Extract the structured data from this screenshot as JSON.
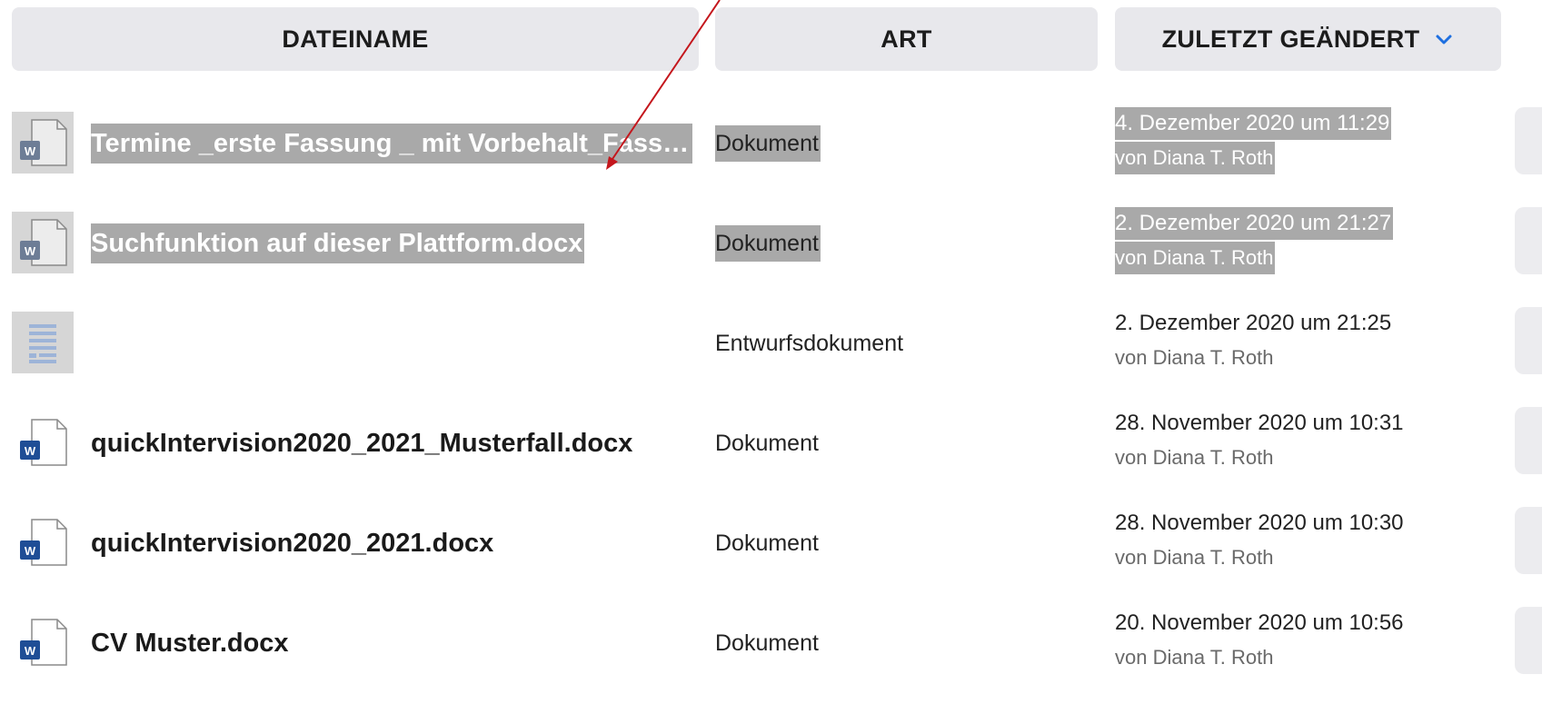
{
  "headers": {
    "name": "DATEINAME",
    "type": "ART",
    "date": "ZULETZT GEÄNDERT"
  },
  "rows": [
    {
      "name": "Termine _erste Fassung _ mit Vorbehalt_Fassung",
      "type": "Dokument",
      "date": "4. Dezember 2020 um 11:29",
      "by": "von Diana T. Roth",
      "icon": "word-doc-icon",
      "selected": true
    },
    {
      "name": "Suchfunktion auf dieser Plattform.docx",
      "type": "Dokument",
      "date": "2. Dezember 2020 um 21:27",
      "by": "von Diana T. Roth",
      "icon": "word-doc-icon",
      "selected": true
    },
    {
      "name": "",
      "type": "Entwurfsdokument",
      "date": "2. Dezember 2020 um 21:25",
      "by": "von Diana T. Roth",
      "icon": "draft-doc-icon",
      "selected": false
    },
    {
      "name": "quickIntervision2020_2021_Musterfall.docx",
      "type": "Dokument",
      "date": "28. November 2020 um 10:31",
      "by": "von Diana T. Roth",
      "icon": "word-doc-icon",
      "selected": false
    },
    {
      "name": "quickIntervision2020_2021.docx",
      "type": "Dokument",
      "date": "28. November 2020 um 10:30",
      "by": "von Diana T. Roth",
      "icon": "word-doc-icon",
      "selected": false
    },
    {
      "name": "CV Muster.docx",
      "type": "Dokument",
      "date": "20. November 2020 um 10:56",
      "by": "von Diana T. Roth",
      "icon": "word-doc-icon",
      "selected": false
    }
  ],
  "colors": {
    "header_bg": "#e8e8ec",
    "selection_bg": "#a9a9a9",
    "word_blue": "#1f4e96",
    "accent_chevron": "#1e6fe0",
    "annotation_arrow": "#c4161c"
  }
}
